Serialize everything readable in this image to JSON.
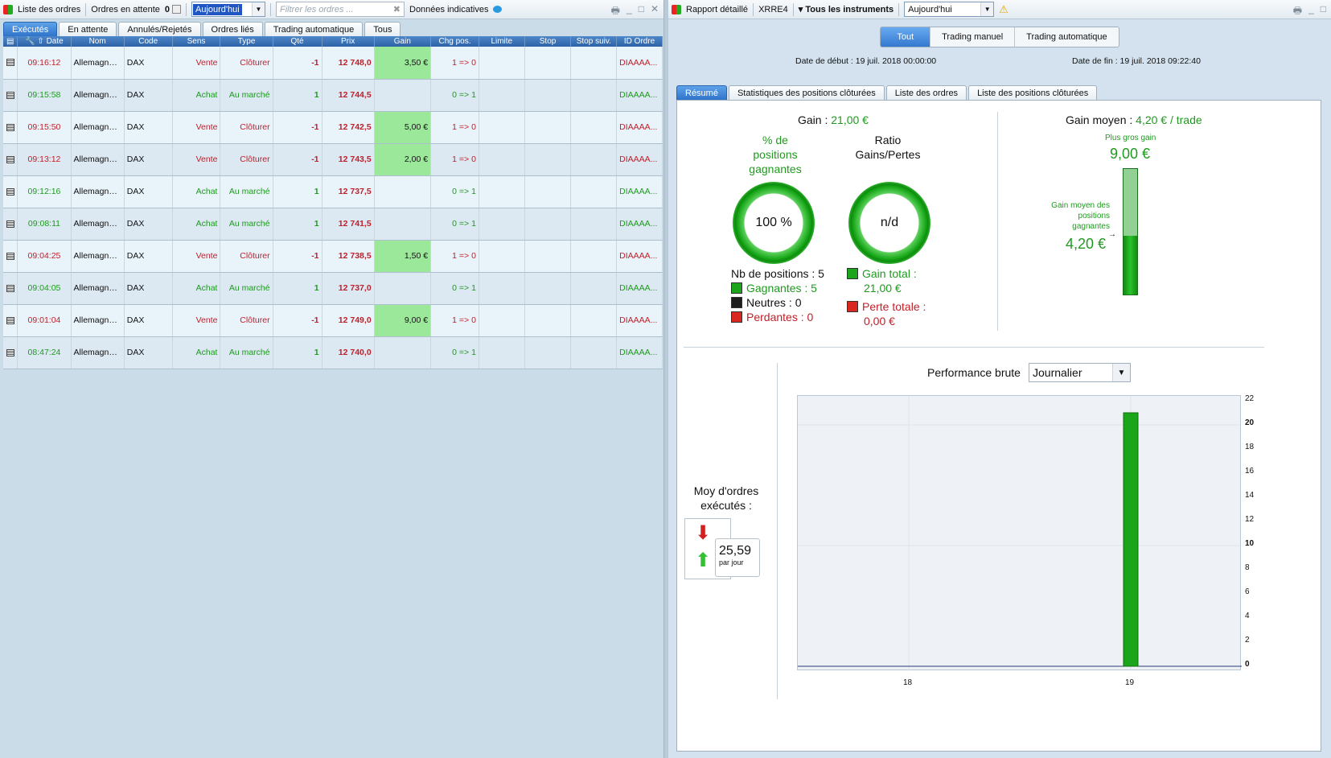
{
  "left": {
    "toolbar": {
      "list_label": "Liste des ordres",
      "pending_label": "Ordres en attente",
      "pending_count": "0",
      "period": "Aujourd'hui",
      "filter_placeholder": "Filtrer les ordres ...",
      "data_label": "Données indicatives"
    },
    "tabs": [
      "Exécutés",
      "En attente",
      "Annulés/Rejetés",
      "Ordres liés",
      "Trading automatique",
      "Tous"
    ],
    "columns": [
      "Date",
      "Nom",
      "Code",
      "Sens",
      "Type",
      "Qté",
      "Prix",
      "Gain",
      "Chg pos.",
      "Limite",
      "Stop",
      "Stop suiv.",
      "ID Ordre"
    ],
    "rows": [
      {
        "time": "09:16:12",
        "name": "Allemagne ...",
        "code": "DAX",
        "side": "Vente",
        "type": "Clôturer",
        "qty": "-1",
        "price": "12 748,0",
        "gain": "3,50 €",
        "chg": "1 => 0",
        "id": "DIAAAA..."
      },
      {
        "time": "09:15:58",
        "name": "Allemagne ...",
        "code": "DAX",
        "side": "Achat",
        "type": "Au marché",
        "qty": "1",
        "price": "12 744,5",
        "gain": "",
        "chg": "0 => 1",
        "id": "DIAAAA..."
      },
      {
        "time": "09:15:50",
        "name": "Allemagne ...",
        "code": "DAX",
        "side": "Vente",
        "type": "Clôturer",
        "qty": "-1",
        "price": "12 742,5",
        "gain": "5,00 €",
        "chg": "1 => 0",
        "id": "DIAAAA..."
      },
      {
        "time": "09:13:12",
        "name": "Allemagne ...",
        "code": "DAX",
        "side": "Vente",
        "type": "Clôturer",
        "qty": "-1",
        "price": "12 743,5",
        "gain": "2,00 €",
        "chg": "1 => 0",
        "id": "DIAAAA..."
      },
      {
        "time": "09:12:16",
        "name": "Allemagne ...",
        "code": "DAX",
        "side": "Achat",
        "type": "Au marché",
        "qty": "1",
        "price": "12 737,5",
        "gain": "",
        "chg": "0 => 1",
        "id": "DIAAAA..."
      },
      {
        "time": "09:08:11",
        "name": "Allemagne ...",
        "code": "DAX",
        "side": "Achat",
        "type": "Au marché",
        "qty": "1",
        "price": "12 741,5",
        "gain": "",
        "chg": "0 => 1",
        "id": "DIAAAA..."
      },
      {
        "time": "09:04:25",
        "name": "Allemagne ...",
        "code": "DAX",
        "side": "Vente",
        "type": "Clôturer",
        "qty": "-1",
        "price": "12 738,5",
        "gain": "1,50 €",
        "chg": "1 => 0",
        "id": "DIAAAA..."
      },
      {
        "time": "09:04:05",
        "name": "Allemagne ...",
        "code": "DAX",
        "side": "Achat",
        "type": "Au marché",
        "qty": "1",
        "price": "12 737,0",
        "gain": "",
        "chg": "0 => 1",
        "id": "DIAAAA..."
      },
      {
        "time": "09:01:04",
        "name": "Allemagne ...",
        "code": "DAX",
        "side": "Vente",
        "type": "Clôturer",
        "qty": "-1",
        "price": "12 749,0",
        "gain": "9,00 €",
        "chg": "1 => 0",
        "id": "DIAAAA..."
      },
      {
        "time": "08:47:24",
        "name": "Allemagne ...",
        "code": "DAX",
        "side": "Achat",
        "type": "Au marché",
        "qty": "1",
        "price": "12 740,0",
        "gain": "",
        "chg": "0 => 1",
        "id": "DIAAAA..."
      }
    ]
  },
  "right": {
    "toolbar": {
      "report_label": "Rapport détaillé",
      "account": "XRRE4",
      "instruments": "Tous les instruments",
      "period": "Aujourd'hui"
    },
    "segments": [
      "Tout",
      "Trading manuel",
      "Trading automatique"
    ],
    "start_label": "Date de début :",
    "start_value": "19 juil. 2018 00:00:00",
    "end_label": "Date de fin :",
    "end_value": "19 juil. 2018 09:22:40",
    "tabs": [
      "Résumé",
      "Statistiques des positions clôturées",
      "Liste des ordres",
      "Liste des positions clôturées"
    ],
    "summary": {
      "gain_label": "Gain :",
      "gain_value": "21,00 €",
      "pct_title": "% de positions gagnantes",
      "pct_value": "100 %",
      "ratio_title": "Ratio Gains/Pertes",
      "ratio_value": "n/d",
      "nb_positions": "Nb de positions : 5",
      "winners": "Gagnantes : 5",
      "neutrals": "Neutres : 0",
      "losers": "Perdantes : 0",
      "total_gain_label": "Gain total :",
      "total_gain_value": "21,00 €",
      "total_loss_label": "Perte totale :",
      "total_loss_value": "0,00 €",
      "avg_gain_label": "Gain moyen :",
      "avg_gain_value": "4,20 € / trade",
      "max_gain_label": "Plus gros gain",
      "max_gain_value": "9,00 €",
      "avg_win_label": "Gain moyen des positions gagnantes",
      "avg_win_value": "4,20 €",
      "avg_orders_label": "Moy d'ordres exécutés :",
      "avg_orders_value": "25,59",
      "avg_orders_unit": "par jour",
      "perf_label": "Performance brute",
      "perf_period": "Journalier"
    }
  },
  "chart_data": {
    "type": "bar",
    "categories": [
      "18",
      "19"
    ],
    "values": [
      0,
      21
    ],
    "ylim": [
      0,
      22
    ],
    "yticks": [
      0,
      2,
      4,
      6,
      8,
      10,
      12,
      14,
      16,
      18,
      20,
      22
    ],
    "bar_color": "#1aa51a",
    "grid": true
  }
}
